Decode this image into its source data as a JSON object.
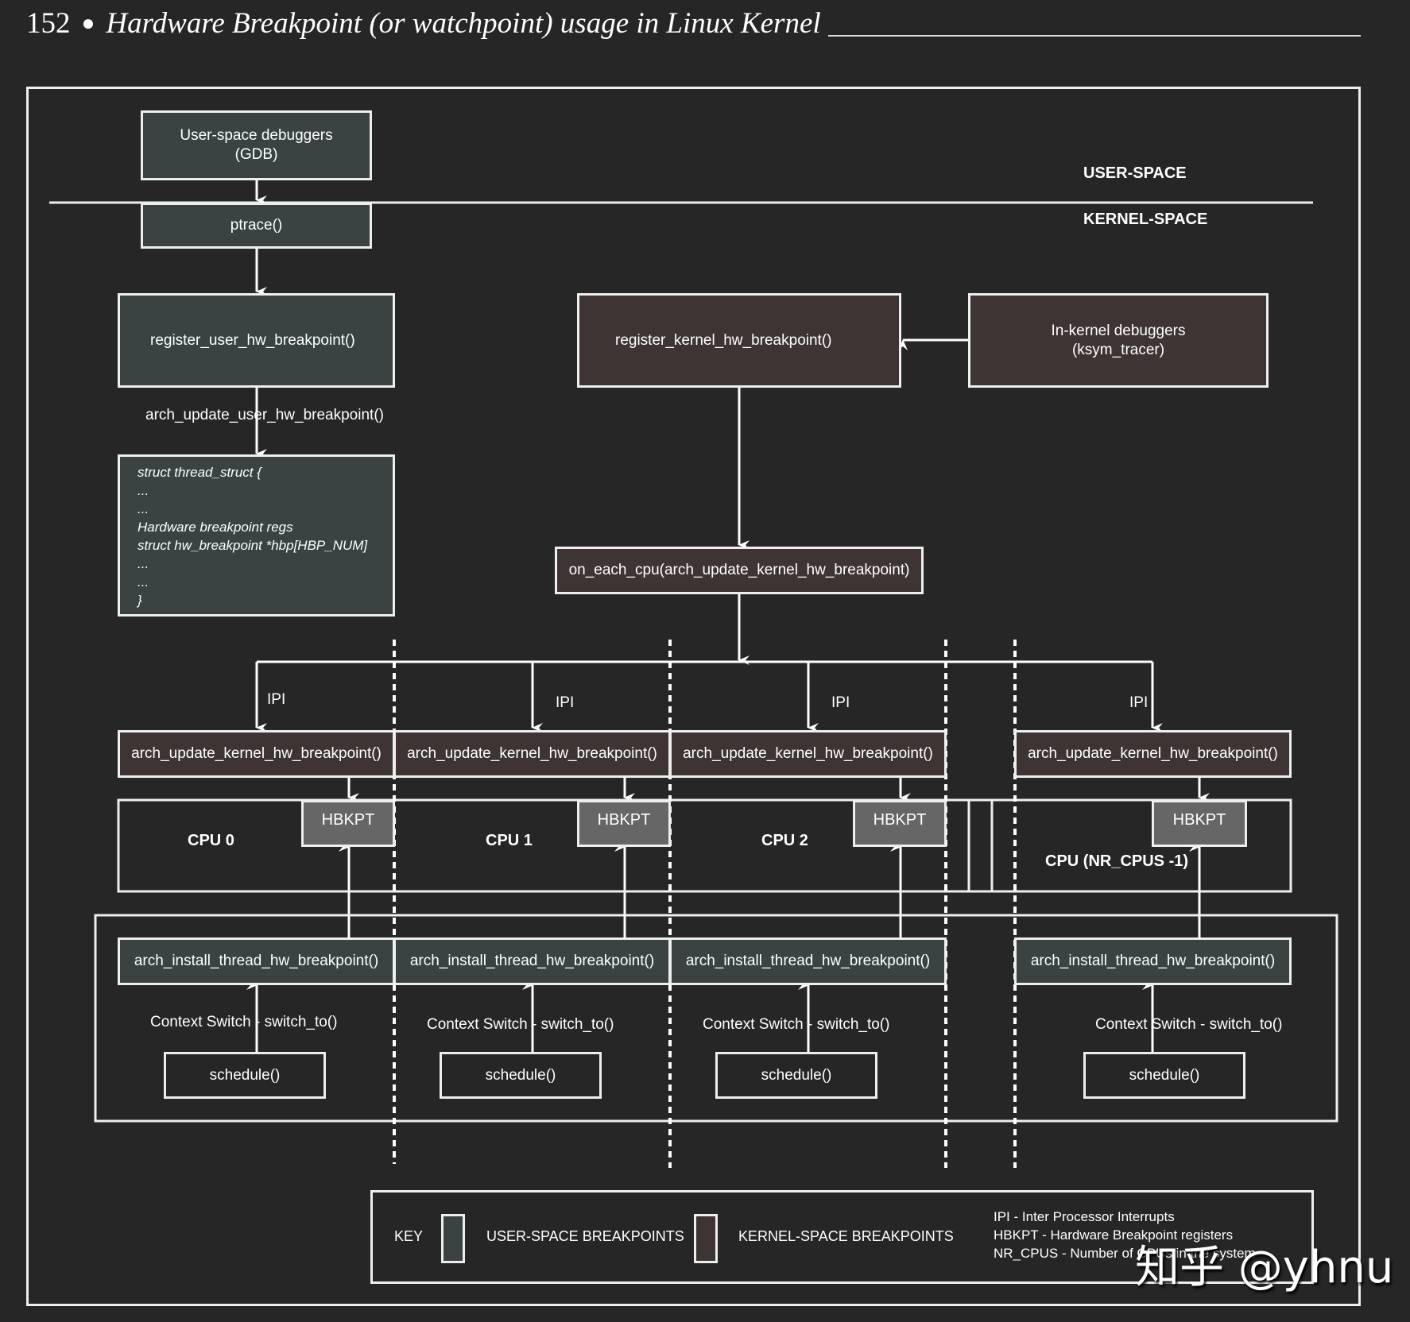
{
  "header": {
    "page_number": "152",
    "bullet": "●",
    "title": "Hardware Breakpoint (or watchpoint) usage in Linux Kernel"
  },
  "regions": {
    "user_space": "USER-SPACE",
    "kernel_space": "KERNEL-SPACE"
  },
  "boxes": {
    "user_debuggers": [
      "User-space debuggers",
      "(GDB)"
    ],
    "ptrace": "ptrace()",
    "register_user": "register_user_hw_breakpoint()",
    "arch_update_user_label": "arch_update_user_hw_breakpoint()",
    "thread_struct": [
      "struct thread_struct {",
      "...",
      "...",
      "Hardware breakpoint regs",
      "struct hw_breakpoint *hbp[HBP_NUM]",
      "...",
      "...",
      "}"
    ],
    "register_kernel": "register_kernel_hw_breakpoint()",
    "in_kernel_debuggers": [
      "In-kernel debuggers",
      "(ksym_tracer)"
    ],
    "on_each_cpu": "on_each_cpu(arch_update_kernel_hw_breakpoint)"
  },
  "cpus": [
    {
      "name": "CPU 0",
      "ipi": "IPI",
      "update": "arch_update_kernel_hw_breakpoint()",
      "hbkpt": "HBKPT",
      "install": "arch_install_thread_hw_breakpoint()",
      "context": "Context Switch - switch_to()",
      "schedule": "schedule()"
    },
    {
      "name": "CPU 1",
      "ipi": "IPI",
      "update": "arch_update_kernel_hw_breakpoint()",
      "hbkpt": "HBKPT",
      "install": "arch_install_thread_hw_breakpoint()",
      "context": "Context Switch - switch_to()",
      "schedule": "schedule()"
    },
    {
      "name": "CPU 2",
      "ipi": "IPI",
      "update": "arch_update_kernel_hw_breakpoint()",
      "hbkpt": "HBKPT",
      "install": "arch_install_thread_hw_breakpoint()",
      "context": "Context Switch - switch_to()",
      "schedule": "schedule()"
    },
    {
      "name": "CPU (NR_CPUS -1)",
      "ipi": "IPI",
      "update": "arch_update_kernel_hw_breakpoint()",
      "hbkpt": "HBKPT",
      "install": "arch_install_thread_hw_breakpoint()",
      "context": "Context Switch - switch_to()",
      "schedule": "schedule()"
    }
  ],
  "key": {
    "title": "KEY",
    "user_label": "USER-SPACE BREAKPOINTS",
    "kernel_label": "KERNEL-SPACE BREAKPOINTS",
    "abbreviations": [
      "IPI - Inter Processor Interrupts",
      "HBKPT - Hardware Breakpoint registers",
      "NR_CPUS - Number of CPUs in the system"
    ]
  },
  "watermark": "知乎 @yhnu",
  "colors": {
    "background": "#262626",
    "user_space_fill": "#3a4342",
    "kernel_space_fill": "#3f3434",
    "hbkpt_fill": "#666666",
    "line": "#eeeeee"
  }
}
